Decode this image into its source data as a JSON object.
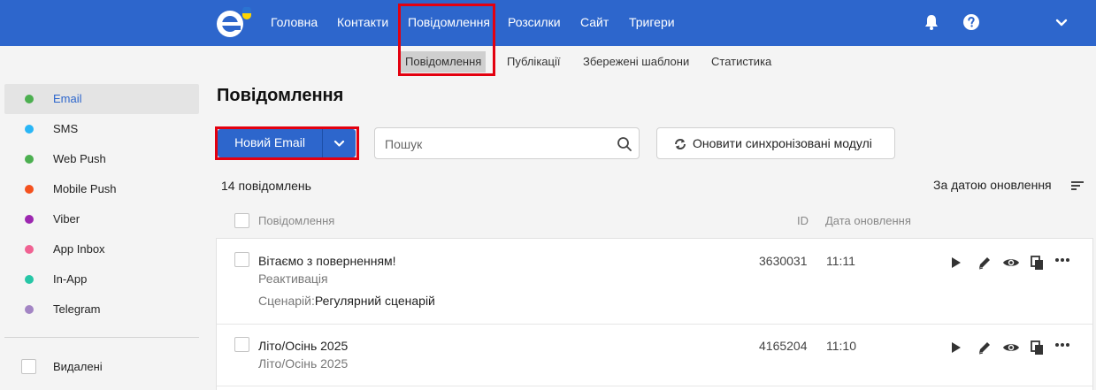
{
  "topnav": {
    "items": [
      "Головна",
      "Контакти",
      "Повідомлення",
      "Розсилки",
      "Сайт",
      "Тригери"
    ],
    "logo_icon": "esputnik-logo-icon",
    "bell_icon": "bell-icon",
    "help_icon": "help-icon",
    "menu_icon": "chevron-down-icon",
    "bg_color": "#2d66cc"
  },
  "subnav": {
    "items": [
      "Повідомлення",
      "Публікації",
      "Збережені шаблони",
      "Статистика"
    ],
    "active": "Повідомлення"
  },
  "sidebar": {
    "items": [
      {
        "label": "Email",
        "color": "#4caf50"
      },
      {
        "label": "SMS",
        "color": "#29b6f6"
      },
      {
        "label": "Web Push",
        "color": "#4caf50"
      },
      {
        "label": "Mobile Push",
        "color": "#f4511e"
      },
      {
        "label": "Viber",
        "color": "#9c27b0"
      },
      {
        "label": "App Inbox",
        "color": "#f06292"
      },
      {
        "label": "In-App",
        "color": "#26c6a6"
      },
      {
        "label": "Telegram",
        "color": "#a385c4"
      }
    ],
    "active": "Email",
    "deleted_label": "Видалені"
  },
  "main": {
    "title": "Повідомлення",
    "new_button": "Новий Email",
    "search_placeholder": "Пошук",
    "sync_button": "Оновити синхронізовані модулі",
    "count": "14 повідомлень",
    "sort_label": "За датою оновлення",
    "columns": {
      "name": "Повідомлення",
      "id": "ID",
      "date": "Дата оновлення"
    },
    "rows": [
      {
        "name": "Вітаємо з поверненням!",
        "subtitle": "Реактивація",
        "scenario_label": "Сценарій:",
        "scenario": "Регулярний сценарій",
        "id": "3630031",
        "time": "11:11"
      },
      {
        "name": "Літо/Осінь 2025",
        "subtitle": "Літо/Осінь 2025",
        "id": "4165204",
        "time": "11:10"
      }
    ],
    "actions": [
      "play-icon",
      "edit-icon",
      "preview-icon",
      "copy-icon",
      "more-icon"
    ]
  }
}
